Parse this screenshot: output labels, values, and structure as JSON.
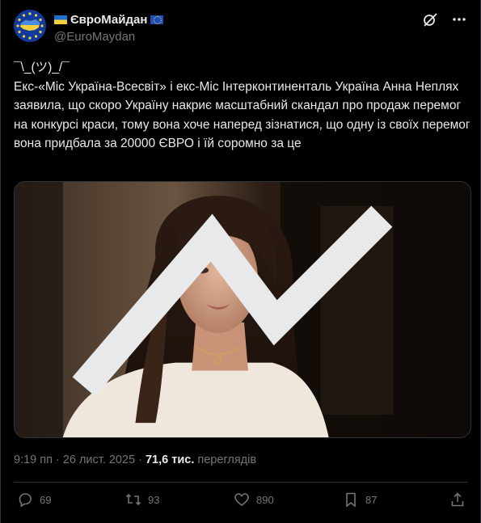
{
  "author": {
    "display_name": "ЄвроМайдан",
    "handle": "@EuroMaydan",
    "avatar_icon": "euromaidan-logo",
    "badges": [
      "ukraine-flag-icon",
      "eu-flag-icon"
    ]
  },
  "header_icons": [
    "grok-icon",
    "more-icon"
  ],
  "tweet": {
    "text": "¯\\_(ツ)_/¯\nЕкс-«Міс Україна-Всесвіт» і екс-Міс Інтерконтиненталь Україна Анна Неплях заявила, що скоро Україну накриє масштабний скандал про продаж перемог на конкурсі краси, тому вона хоче наперед зізнатися, що одну із своїх перемог вона придбала за 20000 ЄВРО і їй соромно за це"
  },
  "media": {
    "type": "image",
    "subject": "woman-with-long-dark-hair",
    "badge_icon": "media-expand-icon"
  },
  "meta": {
    "time": "9:19 пп",
    "separator": "·",
    "date": "26 лист. 2025",
    "views_count": "71,6 тис.",
    "views_label": "переглядів"
  },
  "actions": {
    "replies": "69",
    "reposts": "93",
    "likes": "890",
    "bookmarks": "87"
  },
  "colors": {
    "background": "#000000",
    "text_primary": "#e7e9ea",
    "text_secondary": "#71767b",
    "border": "#2f3336"
  }
}
